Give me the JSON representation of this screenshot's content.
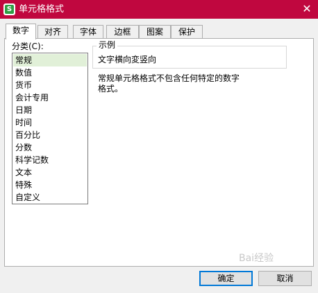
{
  "window": {
    "title": "单元格格式",
    "app_icon_letter": "S",
    "close_glyph": "✕"
  },
  "tabs": [
    {
      "label": "数字",
      "active": true
    },
    {
      "label": "对齐",
      "active": false
    },
    {
      "label": "字体",
      "active": false
    },
    {
      "label": "边框",
      "active": false
    },
    {
      "label": "图案",
      "active": false
    },
    {
      "label": "保护",
      "active": false
    }
  ],
  "category": {
    "label": "分类(C):",
    "items": [
      "常规",
      "数值",
      "货币",
      "会计专用",
      "日期",
      "时间",
      "百分比",
      "分数",
      "科学记数",
      "文本",
      "特殊",
      "自定义"
    ],
    "selected_index": 0
  },
  "sample": {
    "legend": "示例",
    "text": "文字横向変竖向"
  },
  "description": "常规单元格格式不包含任何特定的数字格式。",
  "buttons": {
    "ok": "确定",
    "cancel": "取消"
  },
  "watermark": "Bai经验",
  "colors": {
    "titlebar": "#c0073f",
    "selection": "#e1f0d8",
    "default_button_border": "#0078d7"
  }
}
